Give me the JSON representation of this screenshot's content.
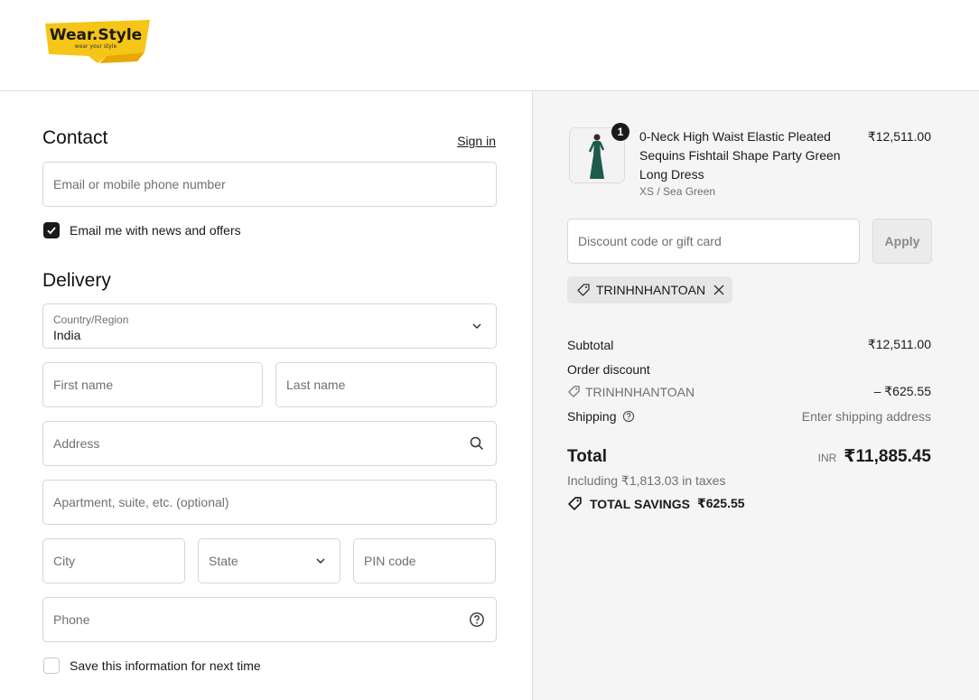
{
  "brand": {
    "name": "Wear.Style",
    "tagline": "wear your style"
  },
  "contact": {
    "title": "Contact",
    "sign_in": "Sign in",
    "email_placeholder": "Email or mobile phone number",
    "newsletter_label": "Email me with news and offers",
    "newsletter_checked": true
  },
  "delivery": {
    "title": "Delivery",
    "country_label": "Country/Region",
    "country_value": "India",
    "first_name_placeholder": "First name",
    "last_name_placeholder": "Last name",
    "address_placeholder": "Address",
    "apartment_placeholder": "Apartment, suite, etc. (optional)",
    "city_placeholder": "City",
    "state_placeholder": "State",
    "pin_placeholder": "PIN code",
    "phone_placeholder": "Phone",
    "save_info_label": "Save this information for next time",
    "save_info_checked": false
  },
  "order": {
    "item": {
      "quantity": "1",
      "name": "0-Neck High Waist Elastic Pleated Sequins Fishtail Shape Party Green Long Dress",
      "variant": "XS / Sea Green",
      "price": "₹12,511.00"
    },
    "discount_placeholder": "Discount code or gift card",
    "apply_label": "Apply",
    "applied_code": "TRINHNHANTOAN",
    "subtotal_label": "Subtotal",
    "subtotal_value": "₹12,511.00",
    "order_discount_label": "Order discount",
    "discount_code": "TRINHNHANTOAN",
    "discount_value": "– ₹625.55",
    "shipping_label": "Shipping",
    "shipping_value": "Enter shipping address",
    "total_label": "Total",
    "currency": "INR",
    "total_value": "₹11,885.45",
    "taxes_note": "Including ₹1,813.03 in taxes",
    "savings_label": "TOTAL SAVINGS",
    "savings_value": "₹625.55"
  },
  "colors": {
    "accent": "#1a1a1a",
    "logo_yellow": "#f5c518",
    "panel_bg": "#f5f5f5"
  }
}
